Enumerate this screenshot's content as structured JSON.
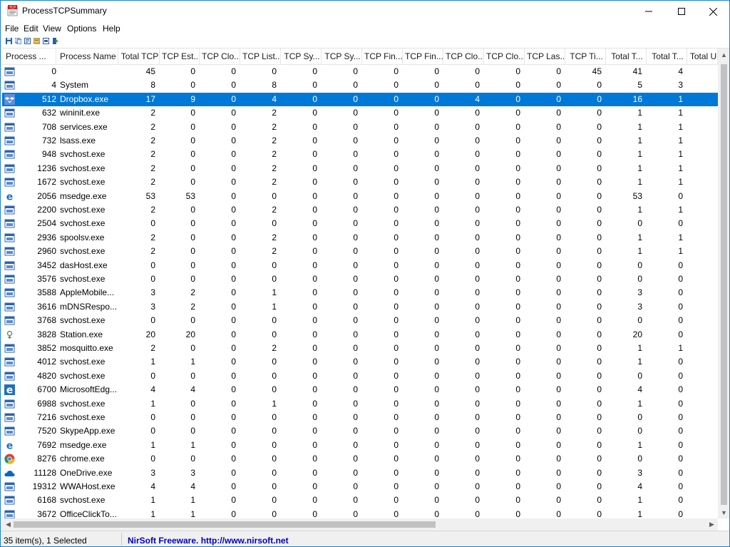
{
  "window": {
    "title": "ProcessTCPSummary"
  },
  "menu": [
    "File",
    "Edit",
    "View",
    "Options",
    "Help"
  ],
  "toolbar_icons": [
    "save-icon",
    "copy-icon",
    "html-report-icon",
    "properties-icon",
    "refresh-icon",
    "exit-icon"
  ],
  "columns": [
    "Process ...",
    "Process Name",
    "Total TCP",
    "TCP Est...",
    "TCP Clo...",
    "TCP List...",
    "TCP Sy...",
    "TCP Sy...",
    "TCP Fin...",
    "TCP Fin...",
    "TCP Clo...",
    "TCP Clo...",
    "TCP Las...",
    "TCP Ti...",
    "Total T...",
    "Total T...",
    "Total U"
  ],
  "rows": [
    {
      "icon": "generic-app-icon",
      "pid": "0",
      "name": "",
      "vals": [
        "45",
        "0",
        "0",
        "0",
        "0",
        "0",
        "0",
        "0",
        "0",
        "0",
        "0",
        "45",
        "41",
        "4"
      ]
    },
    {
      "icon": "generic-app-icon",
      "pid": "4",
      "name": "System",
      "vals": [
        "8",
        "0",
        "0",
        "8",
        "0",
        "0",
        "0",
        "0",
        "0",
        "0",
        "0",
        "0",
        "5",
        "3"
      ]
    },
    {
      "icon": "dropbox-icon",
      "pid": "512",
      "name": "Dropbox.exe",
      "vals": [
        "17",
        "9",
        "0",
        "4",
        "0",
        "0",
        "0",
        "0",
        "4",
        "0",
        "0",
        "0",
        "16",
        "1"
      ],
      "selected": true
    },
    {
      "icon": "generic-app-icon",
      "pid": "632",
      "name": "wininit.exe",
      "vals": [
        "2",
        "0",
        "0",
        "2",
        "0",
        "0",
        "0",
        "0",
        "0",
        "0",
        "0",
        "0",
        "1",
        "1"
      ]
    },
    {
      "icon": "generic-app-icon",
      "pid": "708",
      "name": "services.exe",
      "vals": [
        "2",
        "0",
        "0",
        "2",
        "0",
        "0",
        "0",
        "0",
        "0",
        "0",
        "0",
        "0",
        "1",
        "1"
      ]
    },
    {
      "icon": "generic-app-icon",
      "pid": "732",
      "name": "lsass.exe",
      "vals": [
        "2",
        "0",
        "0",
        "2",
        "0",
        "0",
        "0",
        "0",
        "0",
        "0",
        "0",
        "0",
        "1",
        "1"
      ]
    },
    {
      "icon": "generic-app-icon",
      "pid": "948",
      "name": "svchost.exe",
      "vals": [
        "2",
        "0",
        "0",
        "2",
        "0",
        "0",
        "0",
        "0",
        "0",
        "0",
        "0",
        "0",
        "1",
        "1"
      ]
    },
    {
      "icon": "generic-app-icon",
      "pid": "1236",
      "name": "svchost.exe",
      "vals": [
        "2",
        "0",
        "0",
        "2",
        "0",
        "0",
        "0",
        "0",
        "0",
        "0",
        "0",
        "0",
        "1",
        "1"
      ]
    },
    {
      "icon": "generic-app-icon",
      "pid": "1672",
      "name": "svchost.exe",
      "vals": [
        "2",
        "0",
        "0",
        "2",
        "0",
        "0",
        "0",
        "0",
        "0",
        "0",
        "0",
        "0",
        "1",
        "1"
      ]
    },
    {
      "icon": "edge-icon",
      "pid": "2056",
      "name": "msedge.exe",
      "vals": [
        "53",
        "53",
        "0",
        "0",
        "0",
        "0",
        "0",
        "0",
        "0",
        "0",
        "0",
        "0",
        "53",
        "0"
      ]
    },
    {
      "icon": "generic-app-icon",
      "pid": "2200",
      "name": "svchost.exe",
      "vals": [
        "2",
        "0",
        "0",
        "2",
        "0",
        "0",
        "0",
        "0",
        "0",
        "0",
        "0",
        "0",
        "1",
        "1"
      ]
    },
    {
      "icon": "generic-app-icon",
      "pid": "2504",
      "name": "svchost.exe",
      "vals": [
        "0",
        "0",
        "0",
        "0",
        "0",
        "0",
        "0",
        "0",
        "0",
        "0",
        "0",
        "0",
        "0",
        "0"
      ]
    },
    {
      "icon": "generic-app-icon",
      "pid": "2936",
      "name": "spoolsv.exe",
      "vals": [
        "2",
        "0",
        "0",
        "2",
        "0",
        "0",
        "0",
        "0",
        "0",
        "0",
        "0",
        "0",
        "1",
        "1"
      ]
    },
    {
      "icon": "generic-app-icon",
      "pid": "2960",
      "name": "svchost.exe",
      "vals": [
        "2",
        "0",
        "0",
        "2",
        "0",
        "0",
        "0",
        "0",
        "0",
        "0",
        "0",
        "0",
        "1",
        "1"
      ]
    },
    {
      "icon": "generic-app-icon",
      "pid": "3452",
      "name": "dasHost.exe",
      "vals": [
        "0",
        "0",
        "0",
        "0",
        "0",
        "0",
        "0",
        "0",
        "0",
        "0",
        "0",
        "0",
        "0",
        "0"
      ]
    },
    {
      "icon": "generic-app-icon",
      "pid": "3576",
      "name": "svchost.exe",
      "vals": [
        "0",
        "0",
        "0",
        "0",
        "0",
        "0",
        "0",
        "0",
        "0",
        "0",
        "0",
        "0",
        "0",
        "0"
      ]
    },
    {
      "icon": "generic-app-icon",
      "pid": "3588",
      "name": "AppleMobile...",
      "vals": [
        "3",
        "2",
        "0",
        "1",
        "0",
        "0",
        "0",
        "0",
        "0",
        "0",
        "0",
        "0",
        "3",
        "0"
      ]
    },
    {
      "icon": "generic-app-icon",
      "pid": "3616",
      "name": "mDNSRespo...",
      "vals": [
        "3",
        "2",
        "0",
        "1",
        "0",
        "0",
        "0",
        "0",
        "0",
        "0",
        "0",
        "0",
        "3",
        "0"
      ]
    },
    {
      "icon": "generic-app-icon",
      "pid": "3768",
      "name": "svchost.exe",
      "vals": [
        "0",
        "0",
        "0",
        "0",
        "0",
        "0",
        "0",
        "0",
        "0",
        "0",
        "0",
        "0",
        "0",
        "0"
      ]
    },
    {
      "icon": "station-icon",
      "pid": "3828",
      "name": "Station.exe",
      "vals": [
        "20",
        "20",
        "0",
        "0",
        "0",
        "0",
        "0",
        "0",
        "0",
        "0",
        "0",
        "0",
        "20",
        "0"
      ]
    },
    {
      "icon": "generic-app-icon",
      "pid": "3852",
      "name": "mosquitto.exe",
      "vals": [
        "2",
        "0",
        "0",
        "2",
        "0",
        "0",
        "0",
        "0",
        "0",
        "0",
        "0",
        "0",
        "1",
        "1"
      ]
    },
    {
      "icon": "generic-app-icon",
      "pid": "4012",
      "name": "svchost.exe",
      "vals": [
        "1",
        "1",
        "0",
        "0",
        "0",
        "0",
        "0",
        "0",
        "0",
        "0",
        "0",
        "0",
        "1",
        "0"
      ]
    },
    {
      "icon": "generic-app-icon",
      "pid": "4820",
      "name": "svchost.exe",
      "vals": [
        "0",
        "0",
        "0",
        "0",
        "0",
        "0",
        "0",
        "0",
        "0",
        "0",
        "0",
        "0",
        "0",
        "0"
      ]
    },
    {
      "icon": "edge-legacy-icon",
      "pid": "6700",
      "name": "MicrosoftEdg...",
      "vals": [
        "4",
        "4",
        "0",
        "0",
        "0",
        "0",
        "0",
        "0",
        "0",
        "0",
        "0",
        "0",
        "4",
        "0"
      ]
    },
    {
      "icon": "generic-app-icon",
      "pid": "6988",
      "name": "svchost.exe",
      "vals": [
        "1",
        "0",
        "0",
        "1",
        "0",
        "0",
        "0",
        "0",
        "0",
        "0",
        "0",
        "0",
        "1",
        "0"
      ]
    },
    {
      "icon": "generic-app-icon",
      "pid": "7216",
      "name": "svchost.exe",
      "vals": [
        "0",
        "0",
        "0",
        "0",
        "0",
        "0",
        "0",
        "0",
        "0",
        "0",
        "0",
        "0",
        "0",
        "0"
      ]
    },
    {
      "icon": "generic-app-icon",
      "pid": "7520",
      "name": "SkypeApp.exe",
      "vals": [
        "0",
        "0",
        "0",
        "0",
        "0",
        "0",
        "0",
        "0",
        "0",
        "0",
        "0",
        "0",
        "0",
        "0"
      ]
    },
    {
      "icon": "edge-icon",
      "pid": "7692",
      "name": "msedge.exe",
      "vals": [
        "1",
        "1",
        "0",
        "0",
        "0",
        "0",
        "0",
        "0",
        "0",
        "0",
        "0",
        "0",
        "1",
        "0"
      ]
    },
    {
      "icon": "chrome-icon",
      "pid": "8276",
      "name": "chrome.exe",
      "vals": [
        "0",
        "0",
        "0",
        "0",
        "0",
        "0",
        "0",
        "0",
        "0",
        "0",
        "0",
        "0",
        "0",
        "0"
      ]
    },
    {
      "icon": "onedrive-icon",
      "pid": "11128",
      "name": "OneDrive.exe",
      "vals": [
        "3",
        "3",
        "0",
        "0",
        "0",
        "0",
        "0",
        "0",
        "0",
        "0",
        "0",
        "0",
        "3",
        "0"
      ]
    },
    {
      "icon": "generic-app-icon",
      "pid": "19312",
      "name": "WWAHost.exe",
      "vals": [
        "4",
        "4",
        "0",
        "0",
        "0",
        "0",
        "0",
        "0",
        "0",
        "0",
        "0",
        "0",
        "4",
        "0"
      ]
    },
    {
      "icon": "generic-app-icon",
      "pid": "6168",
      "name": "svchost.exe",
      "vals": [
        "1",
        "1",
        "0",
        "0",
        "0",
        "0",
        "0",
        "0",
        "0",
        "0",
        "0",
        "0",
        "1",
        "0"
      ]
    },
    {
      "icon": "generic-app-icon",
      "pid": "3672",
      "name": "OfficeClickTo...",
      "vals": [
        "1",
        "1",
        "0",
        "0",
        "0",
        "0",
        "0",
        "0",
        "0",
        "0",
        "0",
        "0",
        "1",
        "0"
      ]
    }
  ],
  "status": {
    "count": "35 item(s), 1 Selected",
    "link": "NirSoft Freeware.  http://www.nirsoft.net"
  },
  "colors": {
    "selection": "#0078d7",
    "link": "#0000c0"
  }
}
